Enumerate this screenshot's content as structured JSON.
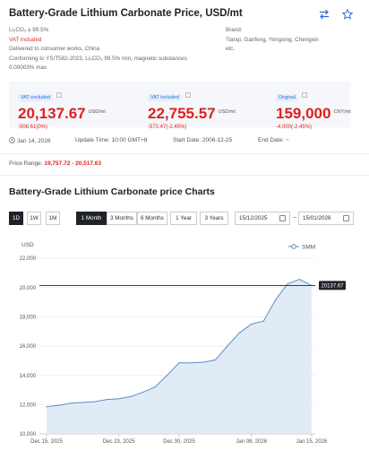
{
  "header": {
    "title": "Battery-Grade Lithium Carbonate Price, USD/mt",
    "icons": [
      "convert-icon",
      "star-icon"
    ]
  },
  "specs": {
    "left": {
      "line1": "Li₂CO₃ ≥ 99.5%",
      "vat": "VAT included",
      "line3": "Delivered to consumer works, China",
      "line4": "Conforming to YS/T582-2023, Li₂CO₃ 99.5% min, magnetic substances",
      "line5": "0.00003% max"
    },
    "right": {
      "brand_label": "Brand:",
      "brand_value": "Tianqi, Ganfeng, Yongxing, Chengxin",
      "brand_etc": "etc."
    }
  },
  "prices": [
    {
      "tag": "VAT excluded",
      "value": "20,137.67",
      "unit": "USD/mt",
      "change": "-506.61(0%)"
    },
    {
      "tag": "VAT included",
      "value": "22,755.57",
      "unit": "USD/mt",
      "change": "-572.47(-2.45%)"
    },
    {
      "tag": "Original",
      "value": "159,000",
      "unit": "CNY/mt",
      "change": "-4,000(-2.45%)"
    }
  ],
  "meta": {
    "date": "Jan 14, 2026",
    "update_time": "Update Time: 10:00 GMT+8",
    "start_date": "Start Date: 2006-12-25",
    "end_date": "End Date: ~"
  },
  "price_range": {
    "label": "Price Range: ",
    "value": "19,757.72 - 20,517.63"
  },
  "chart_section_title": "Battery-Grade Lithium Carbonate price Charts",
  "controls": {
    "views": [
      "1D",
      "1W",
      "1M"
    ],
    "active_view": "1D",
    "ranges": [
      "1 Month",
      "3 Months",
      "6 Months",
      "1 Year",
      "3 Years"
    ],
    "active_range": "1 Month",
    "date_from": "15/12/2025",
    "date_to": "15/01/2026",
    "tilde": "~"
  },
  "chart_data": {
    "type": "area",
    "ylabel": "USD",
    "legend": "SMM",
    "legend_position": "top-right",
    "ylim": [
      10000,
      22000
    ],
    "yticks": [
      "22,000",
      "20,000",
      "18,000",
      "16,000",
      "14,000",
      "12,000",
      "10,000"
    ],
    "xtick_labels": [
      "Dec 15, 2025",
      "Dec 23, 2025",
      "Dec 30, 2025",
      "Jan 08, 2026",
      "Jan 15, 2026"
    ],
    "xtick_index": [
      0,
      6,
      11,
      17,
      22
    ],
    "reference_line": 20137.67,
    "reference_label": "20137.67",
    "series": [
      {
        "name": "SMM",
        "values": [
          11850,
          11950,
          12100,
          12150,
          12200,
          12350,
          12400,
          12550,
          12850,
          13200,
          14000,
          14850,
          14850,
          14900,
          15050,
          16000,
          16900,
          17500,
          17700,
          19150,
          20250,
          20550,
          20138
        ]
      }
    ],
    "colors": {
      "line": "#5b8fc7",
      "fill": "#dce8f5",
      "reference": "#1f2329"
    },
    "grid": true
  }
}
